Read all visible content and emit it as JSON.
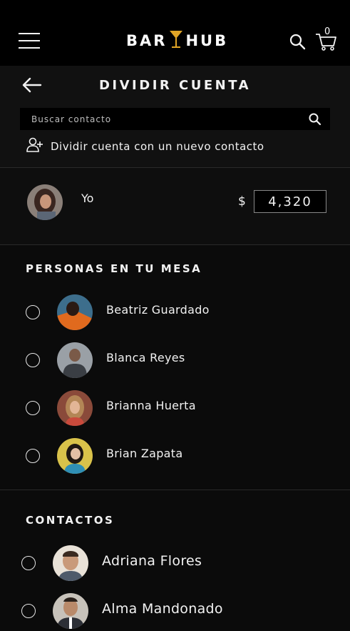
{
  "app": {
    "logo_left": "BAR",
    "logo_right": "HUB",
    "cart_count": "0"
  },
  "page": {
    "title": "DIVIDIR CUENTA"
  },
  "search": {
    "placeholder": "Buscar contacto"
  },
  "new_contact": {
    "label": "Dividir cuenta con un nuevo contacto"
  },
  "me": {
    "name": "Yo",
    "currency": "$",
    "amount": "4,320"
  },
  "table_section": {
    "title": "PERSONAS EN TU MESA",
    "people": [
      {
        "name": "Beatriz Guardado",
        "selected": false
      },
      {
        "name": "Blanca Reyes",
        "selected": false
      },
      {
        "name": "Brianna Huerta",
        "selected": false
      },
      {
        "name": "Brian Zapata",
        "selected": false
      }
    ]
  },
  "contacts_section": {
    "title": "CONTACTOS",
    "contacts": [
      {
        "name": "Adriana Flores",
        "selected": false
      },
      {
        "name": "Alma Mandonado",
        "selected": false
      }
    ]
  },
  "colors": {
    "accent_gold": "#e0a526",
    "background": "#0b0b0b",
    "topbar": "#000000"
  }
}
